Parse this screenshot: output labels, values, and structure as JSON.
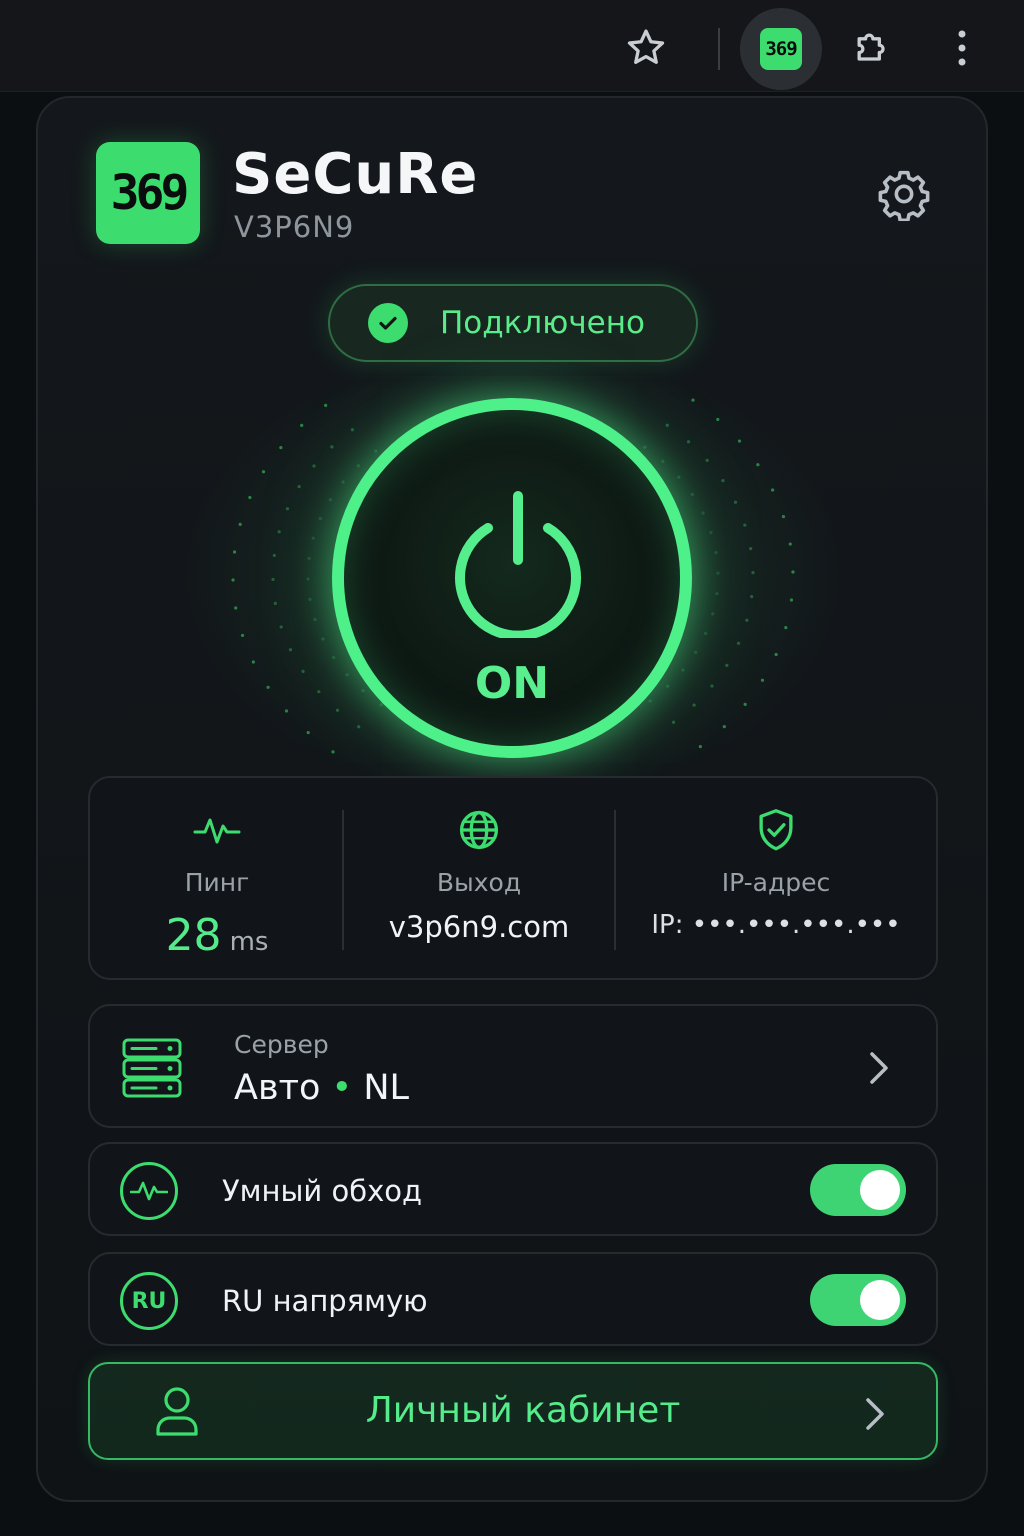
{
  "browser": {
    "star_icon": "star-icon",
    "extension_badge": "369",
    "puzzle_icon": "puzzle-icon",
    "more_icon": "more-vertical-icon"
  },
  "header": {
    "logo_text": "369",
    "title": "SeCuRe",
    "subtitle": "V3P6N9",
    "settings_icon": "gear-icon"
  },
  "status": {
    "label": "Подключено",
    "icon": "check-circle-icon"
  },
  "power": {
    "label": "ON",
    "state": "on"
  },
  "stats": {
    "ping": {
      "label": "Пинг",
      "value": "28",
      "unit": "ms",
      "icon": "pulse-icon"
    },
    "exit": {
      "label": "Выход",
      "value": "v3p6n9.com",
      "icon": "globe-icon"
    },
    "ip": {
      "label": "IP-адрес",
      "value": "IP: •••.•••.•••.•••",
      "icon": "shield-check-icon"
    }
  },
  "server": {
    "label": "Сервер",
    "mode": "Авто",
    "separator": "•",
    "country": "NL",
    "icon": "server-icon"
  },
  "toggles": [
    {
      "label": "Умный обход",
      "icon": "pulse-circle-icon",
      "enabled": true
    },
    {
      "label": "RU напрямую",
      "icon_text": "RU",
      "enabled": true
    }
  ],
  "cabinet": {
    "label": "Личный кабинет",
    "icon": "user-icon"
  },
  "colors": {
    "accent": "#3ddc6e",
    "background": "#0c0f12",
    "card": "#11151a"
  }
}
